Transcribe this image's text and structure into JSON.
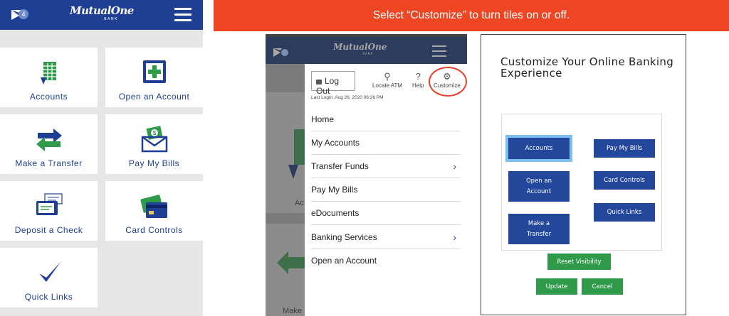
{
  "banner": {
    "text": "Select “Customize” to turn tiles on or off."
  },
  "app": {
    "brand_name": "MutualOne",
    "brand_sub": "BANK",
    "mail_badge": "4"
  },
  "tiles": [
    {
      "label": "Accounts",
      "icon": "accounts-spreadsheet-icon"
    },
    {
      "label": "Open an Account",
      "icon": "plus-box-icon"
    },
    {
      "label": "Make a Transfer",
      "icon": "transfer-arrows-icon"
    },
    {
      "label": "Pay My Bills",
      "icon": "bill-envelope-icon"
    },
    {
      "label": "Deposit a Check",
      "icon": "check-deposit-icon"
    },
    {
      "label": "Card Controls",
      "icon": "credit-card-icon"
    },
    {
      "label": "Quick Links",
      "icon": "checkmark-icon"
    }
  ],
  "menu": {
    "logout": "Log Out",
    "locate_atm": "Locate ATM",
    "help": "Help",
    "customize": "Customize",
    "last_login": "Last Login: Aug 26, 2020 06:26 PM",
    "items": [
      {
        "label": "Home",
        "chevron": false
      },
      {
        "label": "My Accounts",
        "chevron": false
      },
      {
        "label": "Transfer Funds",
        "chevron": true
      },
      {
        "label": "Pay My Bills",
        "chevron": false
      },
      {
        "label": "eDocuments",
        "chevron": false
      },
      {
        "label": "Banking Services",
        "chevron": true
      },
      {
        "label": "Open an Account",
        "chevron": false
      }
    ],
    "ghost_labels": [
      "Ac",
      "Make"
    ]
  },
  "customize": {
    "title": "Customize Your Online Banking Experience",
    "tiles_left": [
      "Accounts",
      "Open an Account",
      "Make a Transfer"
    ],
    "tiles_right": [
      "Pay My Bills",
      "Card Controls",
      "Quick Links"
    ],
    "reset_label": "Reset Visibility",
    "update_label": "Update",
    "cancel_label": "Cancel"
  },
  "colors": {
    "brand_blue": "#1e3f94",
    "banner_orange": "#ee4523",
    "tile_blue": "#23479b",
    "selection_ring": "#7cc0f0",
    "action_green": "#2e9a4a",
    "highlight_red": "#e8402a",
    "icon_green": "#2e9a4a"
  }
}
